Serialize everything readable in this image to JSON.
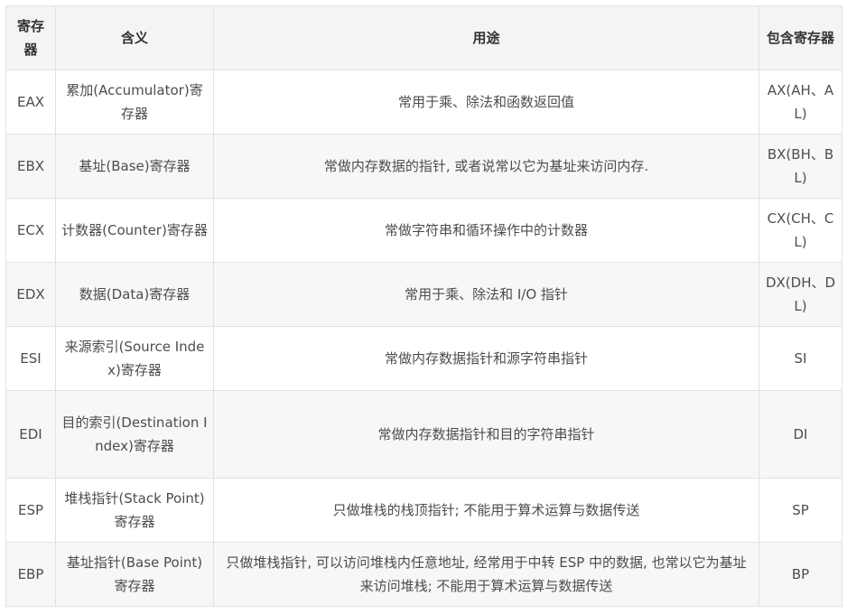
{
  "table": {
    "headers": {
      "register": "寄存器",
      "meaning": "含义",
      "usage": "用途",
      "contains": "包含寄存器"
    },
    "rows": [
      {
        "register": "EAX",
        "meaning": "累加(Accumulator)寄存器",
        "usage": "常用于乘、除法和函数返回值",
        "contains": "AX(AH、AL)"
      },
      {
        "register": "EBX",
        "meaning": "基址(Base)寄存器",
        "usage": "常做内存数据的指针, 或者说常以它为基址来访问内存.",
        "contains": "BX(BH、BL)"
      },
      {
        "register": "ECX",
        "meaning": "计数器(Counter)寄存器",
        "usage": "常做字符串和循环操作中的计数器",
        "contains": "CX(CH、CL)"
      },
      {
        "register": "EDX",
        "meaning": "数据(Data)寄存器",
        "usage": "常用于乘、除法和 I/O 指针",
        "contains": "DX(DH、DL)"
      },
      {
        "register": "ESI",
        "meaning": "来源索引(Source Index)寄存器",
        "usage": "常做内存数据指针和源字符串指针",
        "contains": "SI"
      },
      {
        "register": "EDI",
        "meaning": "目的索引(Destination Index)寄存器",
        "usage": "常做内存数据指针和目的字符串指针",
        "contains": "DI"
      },
      {
        "register": "ESP",
        "meaning": "堆栈指针(Stack Point)寄存器",
        "usage": "只做堆栈的栈顶指针; 不能用于算术运算与数据传送",
        "contains": "SP"
      },
      {
        "register": "EBP",
        "meaning": "基址指针(Base Point)寄存器",
        "usage": "只做堆栈指针, 可以访问堆栈内任意地址, 经常用于中转 ESP 中的数据, 也常以它为基址来访问堆栈; 不能用于算术运算与数据传送",
        "contains": "BP"
      }
    ]
  }
}
